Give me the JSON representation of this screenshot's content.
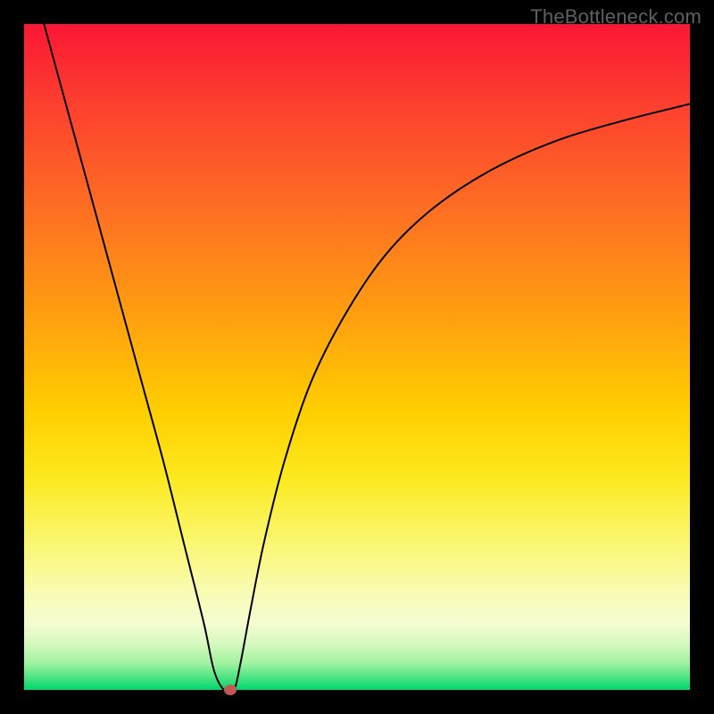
{
  "watermark": "TheBottleneck.com",
  "chart_data": {
    "type": "line",
    "title": "",
    "xlabel": "",
    "ylabel": "",
    "xlim": [
      0,
      100
    ],
    "ylim": [
      0,
      100
    ],
    "grid": false,
    "legend": false,
    "background_gradient": {
      "direction": "vertical",
      "stops": [
        {
          "pos": 0,
          "color": "#fb1735"
        },
        {
          "pos": 12,
          "color": "#fd3f2f"
        },
        {
          "pos": 28,
          "color": "#fe6f23"
        },
        {
          "pos": 44,
          "color": "#ffa00f"
        },
        {
          "pos": 58,
          "color": "#ffce00"
        },
        {
          "pos": 68,
          "color": "#fce91e"
        },
        {
          "pos": 78,
          "color": "#faf772"
        },
        {
          "pos": 85,
          "color": "#f9fbb1"
        },
        {
          "pos": 90,
          "color": "#f5fcd1"
        },
        {
          "pos": 93,
          "color": "#d7f9c0"
        },
        {
          "pos": 96,
          "color": "#a0f2a0"
        },
        {
          "pos": 98.5,
          "color": "#3de17e"
        },
        {
          "pos": 100,
          "color": "#00d56d"
        }
      ]
    },
    "series": [
      {
        "name": "bottleneck-curve",
        "color": "#000000",
        "stroke_width": 2,
        "x": [
          3,
          6,
          9,
          12,
          15,
          18,
          21,
          24,
          27,
          28.5,
          30,
          31.5,
          32.5,
          34,
          36,
          39,
          43,
          48,
          54,
          61,
          70,
          80,
          90,
          100
        ],
        "y": [
          100,
          89,
          78,
          67,
          56,
          45,
          34,
          22,
          10,
          3,
          0,
          0,
          4,
          12,
          22,
          34,
          46,
          56,
          65,
          72,
          78,
          82.5,
          85.5,
          88
        ]
      }
    ],
    "points": [
      {
        "name": "optimal-marker",
        "x": 31,
        "y": 0,
        "color": "#c15a55"
      }
    ]
  }
}
